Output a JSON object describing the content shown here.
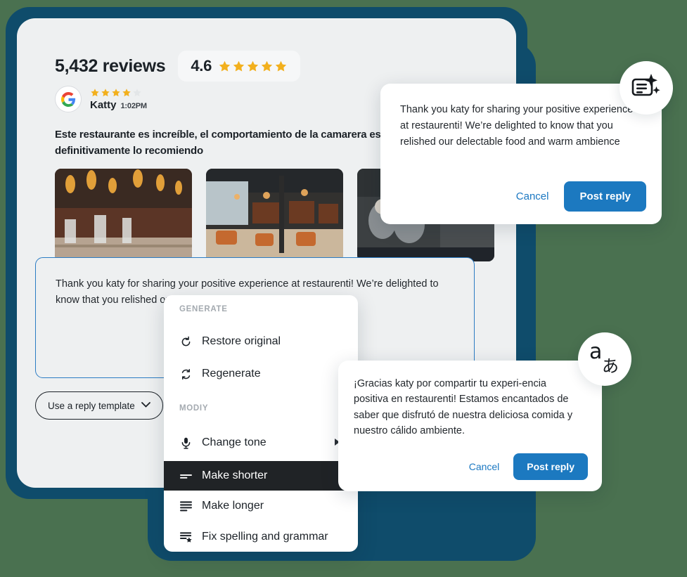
{
  "review": {
    "reviews_count": "5,432 reviews",
    "rating_value": "4.6",
    "rating_stars_filled": 5,
    "reviewer_name": "Katty",
    "reviewer_time": "1:02PM",
    "reviewer_stars_filled": 4,
    "reviewer_stars_total": 5,
    "source_icon": "google-icon",
    "body": "Este restaurante es increíble, el comportamiento de la camarera es excelente, definitivamente lo recomiendo",
    "photos": [
      {
        "alt": "restaurant-interior-pendant-lights"
      },
      {
        "alt": "restaurant-interior-dining-hall"
      },
      {
        "alt": "restaurant-interior-guests-seated"
      }
    ]
  },
  "reply_editor": {
    "value": "Thank you katy for sharing your positive experience at restaurenti! We’re delighted to know that you relished our delectable food and warm ambi‑ence",
    "template_button_label": "Use a reply template",
    "template_chevron": "chevron-down-icon"
  },
  "english_popup": {
    "text": "Thank you katy for sharing your positive experience at restaurenti! We’re delighted to know that you relished our delectable food and warm ambience",
    "cancel_label": "Cancel",
    "post_label": "Post reply"
  },
  "spanish_popup": {
    "text": "¡Gracias katy por compartir tu experi‑encia positiva en restaurenti! Estamos encantados de saber que disfrutó de nuestra deliciosa comida y nuestro cálido ambiente.",
    "cancel_label": "Cancel",
    "post_label": "Post reply"
  },
  "badges": {
    "ai_icon": "ai-generate-icon",
    "translate_latin": "a",
    "translate_japanese": "あ"
  },
  "context_menu": {
    "section_generate": "GENERATE",
    "section_modify": "MODIY",
    "items": [
      {
        "label": "Restore original",
        "icon": "restore-icon"
      },
      {
        "label": "Regenerate",
        "icon": "regenerate-icon"
      },
      {
        "label": "Change tone",
        "icon": "microphone-icon",
        "has_submenu": true
      },
      {
        "label": "Make shorter",
        "icon": "make-shorter-icon",
        "active": true
      },
      {
        "label": "Make longer",
        "icon": "make-longer-icon"
      },
      {
        "label": "Fix spelling and grammar",
        "icon": "spellcheck-icon"
      }
    ]
  },
  "colors": {
    "frame_blue": "#0f4c6b",
    "button_blue": "#1c79c0",
    "link_blue": "#1b78c2",
    "star_gold": "#f2b01e",
    "star_grey": "#e3e6e8",
    "card_bg": "#eef0f1",
    "menu_active_bg": "#202326"
  }
}
